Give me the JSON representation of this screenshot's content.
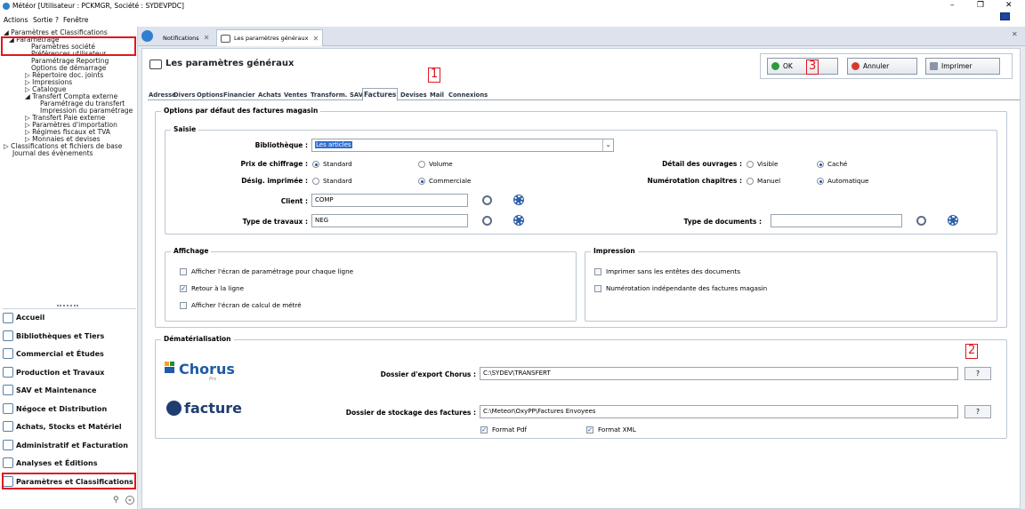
{
  "window": {
    "title": "Météor [Utilisateur : PCKMGR, Société : SYDEVPDC]",
    "minimize": "–",
    "restore": "❐",
    "close": "✕"
  },
  "menu": [
    "Actions",
    "Sortie",
    "?",
    "Fenêtre"
  ],
  "tree": {
    "root": "◢ Paramètres et Classifications",
    "parametrage": "◢ Paramétrage",
    "items": [
      "Paramètres société",
      "Préférences utilisateur",
      "Paramétrage Reporting",
      "Options de démarrage",
      "▷ Répertoire doc. joints",
      "▷ Impressions",
      "▷ Catalogue",
      "◢ Transfert Compta externe",
      "Paramétrage du transfert",
      "Impression du paramétrage",
      "▷ Transfert Paie externe",
      "▷ Paramètres d'importation",
      "▷ Régimes fiscaux et TVA",
      "▷ Monnaies et devises",
      "▷ Classifications et fichiers de base",
      "Journal des évènements"
    ]
  },
  "nav": [
    "Accueil",
    "Bibliothèques et Tiers",
    "Commercial et Études",
    "Production et Travaux",
    "SAV et Maintenance",
    "Négoce et Distribution",
    "Achats, Stocks et Matériel",
    "Administratif et Facturation",
    "Analyses et Éditions",
    "Paramètres et Classifications"
  ],
  "doc_tabs": [
    "Notifications",
    "Les paramètres généraux"
  ],
  "page": {
    "title": "Les paramètres généraux",
    "ok": "OK",
    "cancel": "Annuler",
    "print": "Imprimer"
  },
  "subtabs": [
    "Adresse",
    "Divers",
    "Options",
    "Financier",
    "Achats",
    "Ventes",
    "Transform.",
    "SAV",
    "Factures",
    "Devises",
    "Mail",
    "Connexions"
  ],
  "options_group": "Options par défaut des factures magasin",
  "saisie": {
    "legend": "Saisie",
    "bibliotheque_label": "Bibliothèque :",
    "bibliotheque_value": "Les articles",
    "prix_label": "Prix de chiffrage :",
    "prix_opt1": "Standard",
    "prix_opt2": "Volume",
    "desig_label": "Désig. imprimée :",
    "desig_opt1": "Standard",
    "desig_opt2": "Commerciale",
    "detail_label": "Détail des ouvrages :",
    "detail_opt1": "Visible",
    "detail_opt2": "Caché",
    "numchap_label": "Numérotation chapitres :",
    "numchap_opt1": "Manuel",
    "numchap_opt2": "Automatique",
    "client_label": "Client :",
    "client_value": "COMP",
    "travaux_label": "Type de travaux :",
    "travaux_value": "NEG",
    "typedoc_label": "Type de documents :",
    "typedoc_value": ""
  },
  "affichage": {
    "legend": "Affichage",
    "c1": "Afficher l'écran de paramétrage pour chaque ligne",
    "c2": "Retour à la ligne",
    "c3": "Afficher l'écran de calcul de métré"
  },
  "impression": {
    "legend": "Impression",
    "c1": "Imprimer sans les entêtes des documents",
    "c2": "Numérotation indépendante des factures magasin"
  },
  "demat": {
    "legend": "Dématérialisation",
    "chorus_logo": "Chorus",
    "chorus_sub": "Pro",
    "chorus_label": "Dossier d'export Chorus :",
    "chorus_value": "C:\\SYDEV\\TRANSFERT",
    "efacture_logo": "facture",
    "stock_label": "Dossier de stockage des factures :",
    "stock_value": "C:\\Meteor\\OxyPP\\Factures Envoyees",
    "pdf": "Format Pdf",
    "xml": "Format XML",
    "browse": "?"
  },
  "markers": [
    "1",
    "2",
    "3"
  ],
  "colors": {
    "accent": "#e0171f",
    "brand": "#2b5fa6"
  }
}
